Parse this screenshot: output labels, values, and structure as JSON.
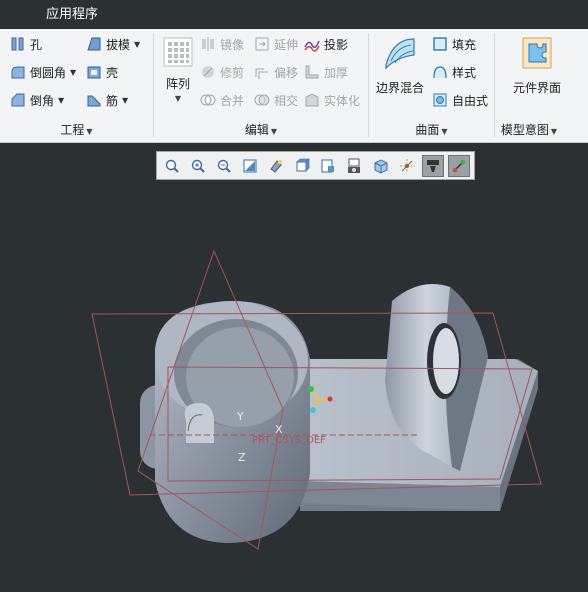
{
  "titlebar": {
    "app_tab": "应用程序"
  },
  "groups": {
    "engineering": {
      "label": "工程",
      "items": [
        {
          "label": "孔",
          "icon": "hole-icon"
        },
        {
          "label": "拔模",
          "icon": "draft-icon"
        },
        {
          "label": "倒圆角",
          "icon": "round-icon"
        },
        {
          "label": "壳",
          "icon": "shell-icon"
        },
        {
          "label": "倒角",
          "icon": "chamfer-icon"
        },
        {
          "label": "筋",
          "icon": "rib-icon"
        }
      ]
    },
    "editing": {
      "label": "编辑",
      "pattern_label": "阵列",
      "items": [
        {
          "label": "镜像",
          "icon": "mirror-icon"
        },
        {
          "label": "延伸",
          "icon": "extend-icon"
        },
        {
          "label": "投影",
          "icon": "project-icon"
        },
        {
          "label": "修剪",
          "icon": "trim-icon"
        },
        {
          "label": "偏移",
          "icon": "offset-icon"
        },
        {
          "label": "加厚",
          "icon": "thicken-icon"
        },
        {
          "label": "合并",
          "icon": "merge-icon"
        },
        {
          "label": "相交",
          "icon": "intersect-icon"
        },
        {
          "label": "实体化",
          "icon": "solidify-icon"
        }
      ]
    },
    "surface": {
      "label": "曲面",
      "boundary_blend_label": "边界混合",
      "items": [
        {
          "label": "填充",
          "icon": "fill-icon"
        },
        {
          "label": "样式",
          "icon": "style-icon"
        },
        {
          "label": "自由式",
          "icon": "freestyle-icon"
        }
      ]
    },
    "model_intent": {
      "label": "模型意图",
      "component_interface_label": "元件界面"
    }
  },
  "view_toolbar": {
    "items": [
      "refit-icon",
      "zoom-in-icon",
      "zoom-out-icon",
      "repaint-icon",
      "display-style-icon",
      "saved-orientations-icon",
      "view-manager-icon",
      "perspective-icon",
      "named-view-icon",
      "spin-center-icon",
      "annotation-display-icon",
      "datum-display-icon"
    ],
    "active": [
      "annotation-display-icon",
      "datum-display-icon"
    ]
  },
  "graphics": {
    "csys_label": "PRT_CSYS_DEF",
    "axis_x": "X",
    "axis_y": "Y",
    "axis_z": "Z"
  },
  "colors": {
    "background": "#2b3033",
    "ribbon": "#f3f4f5",
    "datum_plane": "#b05a66",
    "part": "#a9b3bf"
  }
}
